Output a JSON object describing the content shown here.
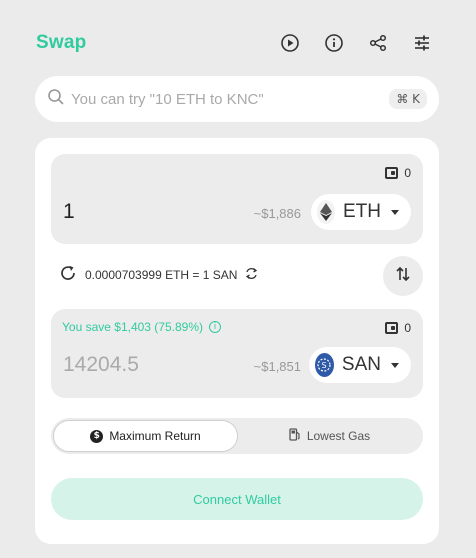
{
  "header": {
    "title": "Swap",
    "icons": [
      "play-circle-icon",
      "info-icon",
      "share-icon",
      "settings-sliders-icon"
    ]
  },
  "search": {
    "placeholder": "You can try \"10 ETH to KNC\"",
    "shortcut": "⌘ K"
  },
  "from": {
    "balance": "0",
    "amount": "1",
    "usd": "~$1,886",
    "token": "ETH"
  },
  "rate": {
    "text": "0.0000703999 ETH = 1 SAN"
  },
  "to": {
    "save_text": "You save $1,403 (75.89%)",
    "balance": "0",
    "amount": "14204.5",
    "usd": "~$1,851",
    "token": "SAN"
  },
  "route_toggle": {
    "options": [
      "Maximum Return",
      "Lowest Gas"
    ],
    "selected": "Maximum Return"
  },
  "connect_label": "Connect Wallet",
  "colors": {
    "accent": "#31cb9e",
    "accent_bg": "#d6f3ea",
    "page_bg": "#ebebeb",
    "san_logo": "#2f5aa8"
  }
}
